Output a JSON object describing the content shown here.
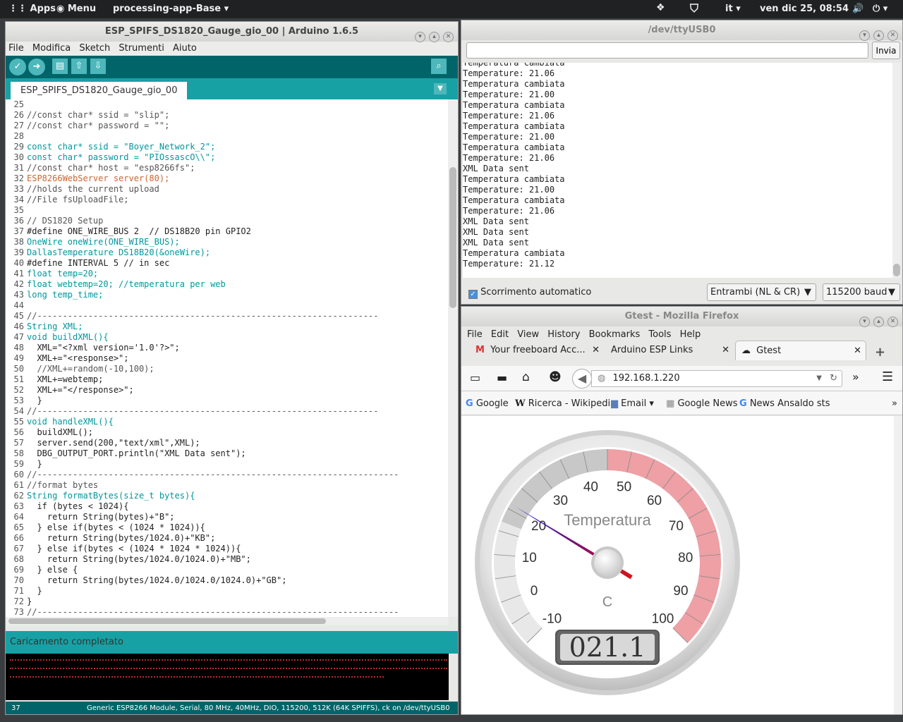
{
  "topbar": {
    "apps": "Apps",
    "menu": "Menu",
    "app_name": "processing-app-Base ▾",
    "lang": "it ▾",
    "datetime": "ven dic 25, 08:54"
  },
  "arduino": {
    "title": "ESP_SPIFS_DS1820_Gauge_gio_00 | Arduino 1.6.5",
    "menu": [
      "File",
      "Modifica",
      "Sketch",
      "Strumenti",
      "Aiuto"
    ],
    "tab": "ESP_SPIFS_DS1820_Gauge_gio_00",
    "code": [
      {
        "n": "25",
        "t": ""
      },
      {
        "n": "26",
        "t": "//const char* ssid = \"slip\";"
      },
      {
        "n": "27",
        "t": "//const char* password = \"\";"
      },
      {
        "n": "28",
        "t": ""
      },
      {
        "n": "29",
        "t": "const char* ssid = \"Boyer_Network_2\";"
      },
      {
        "n": "30",
        "t": "const char* password = \"PIOssascO\\\\\";"
      },
      {
        "n": "31",
        "t": "//const char* host = \"esp8266fs\";"
      },
      {
        "n": "32",
        "t": "ESP8266WebServer server(80);"
      },
      {
        "n": "33",
        "t": "//holds the current upload"
      },
      {
        "n": "34",
        "t": "//File fsUploadFile;"
      },
      {
        "n": "35",
        "t": ""
      },
      {
        "n": "36",
        "t": "// DS1820 Setup"
      },
      {
        "n": "37",
        "t": "#define ONE_WIRE_BUS 2  // DS18B20 pin GPIO2"
      },
      {
        "n": "38",
        "t": "OneWire oneWire(ONE_WIRE_BUS);"
      },
      {
        "n": "39",
        "t": "DallasTemperature DS18B20(&oneWire);"
      },
      {
        "n": "40",
        "t": "#define INTERVAL 5 // in sec"
      },
      {
        "n": "41",
        "t": "float temp=20;"
      },
      {
        "n": "42",
        "t": "float webtemp=20; //temperatura per web"
      },
      {
        "n": "43",
        "t": "long temp_time;"
      },
      {
        "n": "44",
        "t": ""
      },
      {
        "n": "45",
        "t": "//-------------------------------------------------------------------"
      },
      {
        "n": "46",
        "t": "String XML;"
      },
      {
        "n": "47",
        "t": "void buildXML(){"
      },
      {
        "n": "48",
        "t": "  XML=\"<?xml version='1.0'?>\";"
      },
      {
        "n": "49",
        "t": "  XML+=\"<response>\";"
      },
      {
        "n": "50",
        "t": "  //XML+=random(-10,100);"
      },
      {
        "n": "51",
        "t": "  XML+=webtemp;"
      },
      {
        "n": "52",
        "t": "  XML+=\"</response>\";"
      },
      {
        "n": "53",
        "t": "  }"
      },
      {
        "n": "54",
        "t": "//-------------------------------------------------------------------"
      },
      {
        "n": "55",
        "t": "void handleXML(){"
      },
      {
        "n": "56",
        "t": "  buildXML();"
      },
      {
        "n": "57",
        "t": "  server.send(200,\"text/xml\",XML);"
      },
      {
        "n": "58",
        "t": "  DBG_OUTPUT_PORT.println(\"XML Data sent\");"
      },
      {
        "n": "59",
        "t": "  }"
      },
      {
        "n": "60",
        "t": "//-----------------------------------------------------------------------"
      },
      {
        "n": "61",
        "t": "//format bytes"
      },
      {
        "n": "62",
        "t": "String formatBytes(size_t bytes){"
      },
      {
        "n": "63",
        "t": "  if (bytes < 1024){"
      },
      {
        "n": "64",
        "t": "    return String(bytes)+\"B\";"
      },
      {
        "n": "65",
        "t": "  } else if(bytes < (1024 * 1024)){"
      },
      {
        "n": "66",
        "t": "    return String(bytes/1024.0)+\"KB\";"
      },
      {
        "n": "67",
        "t": "  } else if(bytes < (1024 * 1024 * 1024)){"
      },
      {
        "n": "68",
        "t": "    return String(bytes/1024.0/1024.0)+\"MB\";"
      },
      {
        "n": "69",
        "t": "  } else {"
      },
      {
        "n": "70",
        "t": "    return String(bytes/1024.0/1024.0/1024.0)+\"GB\";"
      },
      {
        "n": "71",
        "t": "  }"
      },
      {
        "n": "72",
        "t": "}"
      },
      {
        "n": "73",
        "t": "//-----------------------------------------------------------------------"
      }
    ],
    "status": "Caricamento completato",
    "line_no": "37",
    "board_info": "Generic ESP8266 Module, Serial, 80 MHz, 40MHz, DIO, 115200, 512K (64K SPIFFS), ck on /dev/ttyUSB0"
  },
  "serial": {
    "title": "/dev/ttyUSB0",
    "send_label": "Invia",
    "input_value": "",
    "lines": [
      "Temperatura cambiata",
      "Temperature: 21.06",
      "Temperatura cambiata",
      "Temperature: 21.00",
      "Temperatura cambiata",
      "Temperature: 21.06",
      "Temperatura cambiata",
      "Temperature: 21.00",
      "Temperatura cambiata",
      "Temperature: 21.06",
      "XML Data sent",
      "Temperatura cambiata",
      "Temperature: 21.00",
      "Temperatura cambiata",
      "Temperature: 21.06",
      "XML Data sent",
      "XML Data sent",
      "XML Data sent",
      "Temperatura cambiata",
      "Temperature: 21.12"
    ],
    "autoscroll_label": "Scorrimento automatico",
    "line_ending": "Entrambi (NL & CR)",
    "baud": "115200 baud"
  },
  "firefox": {
    "title": "Gtest - Mozilla Firefox",
    "menu": [
      "File",
      "Edit",
      "View",
      "History",
      "Bookmarks",
      "Tools",
      "Help"
    ],
    "tabs": [
      "Your freeboard Acc...",
      "Arduino ESP Links",
      "Gtest"
    ],
    "url": "192.168.1.220",
    "bookmarks": [
      "Google",
      "Ricerca - Wikipedia",
      "Email ▾",
      "Google News",
      "News Ansaldo sts"
    ]
  },
  "gauge": {
    "title": "Temperatura",
    "units": "C",
    "value": 21.1,
    "display": "021.1",
    "min": -10,
    "max": 100,
    "ticks": [
      "-10",
      "0",
      "10",
      "20",
      "30",
      "40",
      "50",
      "60",
      "70",
      "80",
      "90",
      "100"
    ],
    "colors": {
      "low": "#e8e8e8",
      "mid": "#c8c8c8",
      "high": "#eea0a5",
      "needle_start": "#1010d0",
      "needle_end": "#e01010"
    }
  }
}
